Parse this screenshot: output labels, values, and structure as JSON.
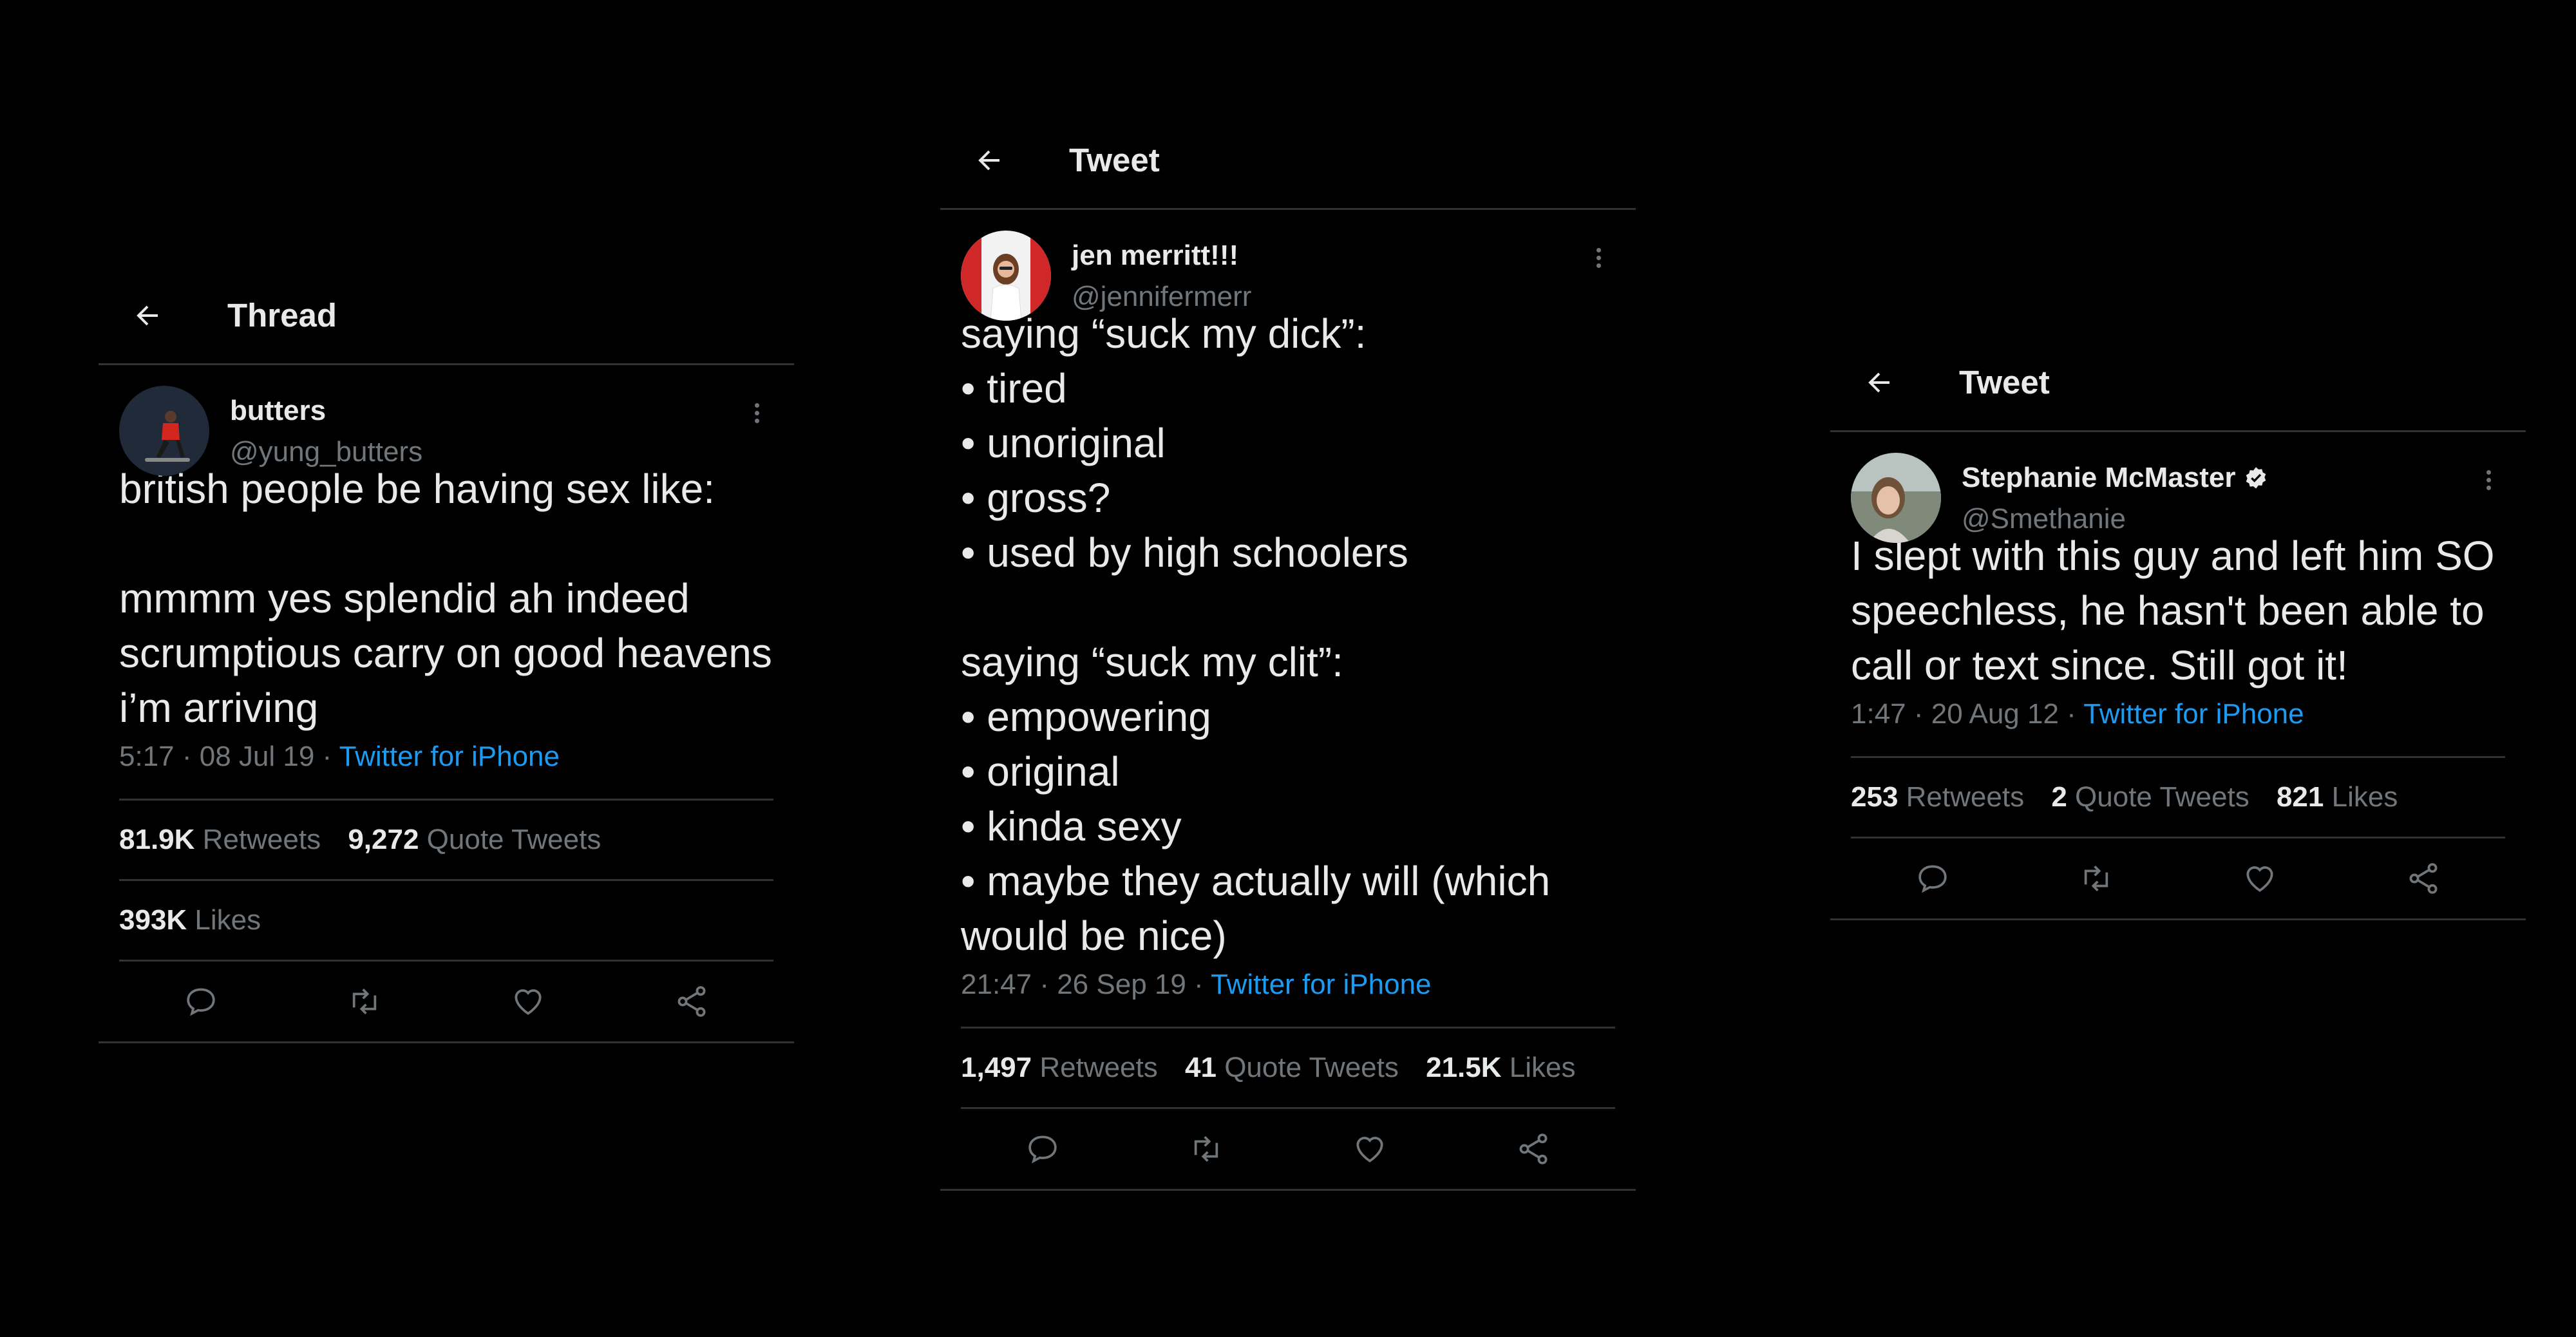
{
  "panels": [
    {
      "header_title": "Thread",
      "name": "butters",
      "handle": "@yung_butters",
      "text": "british people be having sex like:\n\nmmmm yes splendid ah indeed scrumptious carry on good heavens i’m arriving",
      "time": "5:17 · 08 Jul 19 · ",
      "source": "Twitter for iPhone",
      "retweets": "81.9K",
      "retweets_label": "Retweets",
      "quotes": "9,272",
      "quotes_label": "Quote Tweets",
      "likes": "393K",
      "likes_label": "Likes"
    },
    {
      "header_title": "Tweet",
      "name": "jen merritt!!!",
      "handle": "@jennifermerr",
      "text": "saying “suck my dick”:\n• tired\n• unoriginal\n• gross?\n• used by high schoolers\n\nsaying “suck my clit”:\n• empowering\n• original\n• kinda sexy\n• maybe they actually will (which would be nice)",
      "time": "21:47 · 26 Sep 19 · ",
      "source": "Twitter for iPhone",
      "retweets": "1,497",
      "retweets_label": "Retweets",
      "quotes": "41",
      "quotes_label": "Quote Tweets",
      "likes": "21.5K",
      "likes_label": "Likes"
    },
    {
      "header_title": "Tweet",
      "name": "Stephanie McMaster",
      "handle": "@Smethanie",
      "text": "I slept with this guy and left him SO speechless, he hasn't been able to call or text since. Still got it!",
      "time": "1:47 · 20 Aug 12 · ",
      "source": "Twitter for iPhone",
      "retweets": "253",
      "retweets_label": "Retweets",
      "quotes": "2",
      "quotes_label": "Quote Tweets",
      "likes": "821",
      "likes_label": "Likes"
    }
  ],
  "colors": {
    "background": "#000000",
    "text": "#e7e9ea",
    "muted": "#71767b",
    "link": "#1d9bf0",
    "divider": "#2f3336"
  },
  "icons": [
    "back-arrow-icon",
    "more-options-icon",
    "verified-badge-icon",
    "reply-icon",
    "retweet-icon",
    "like-icon",
    "share-icon"
  ]
}
